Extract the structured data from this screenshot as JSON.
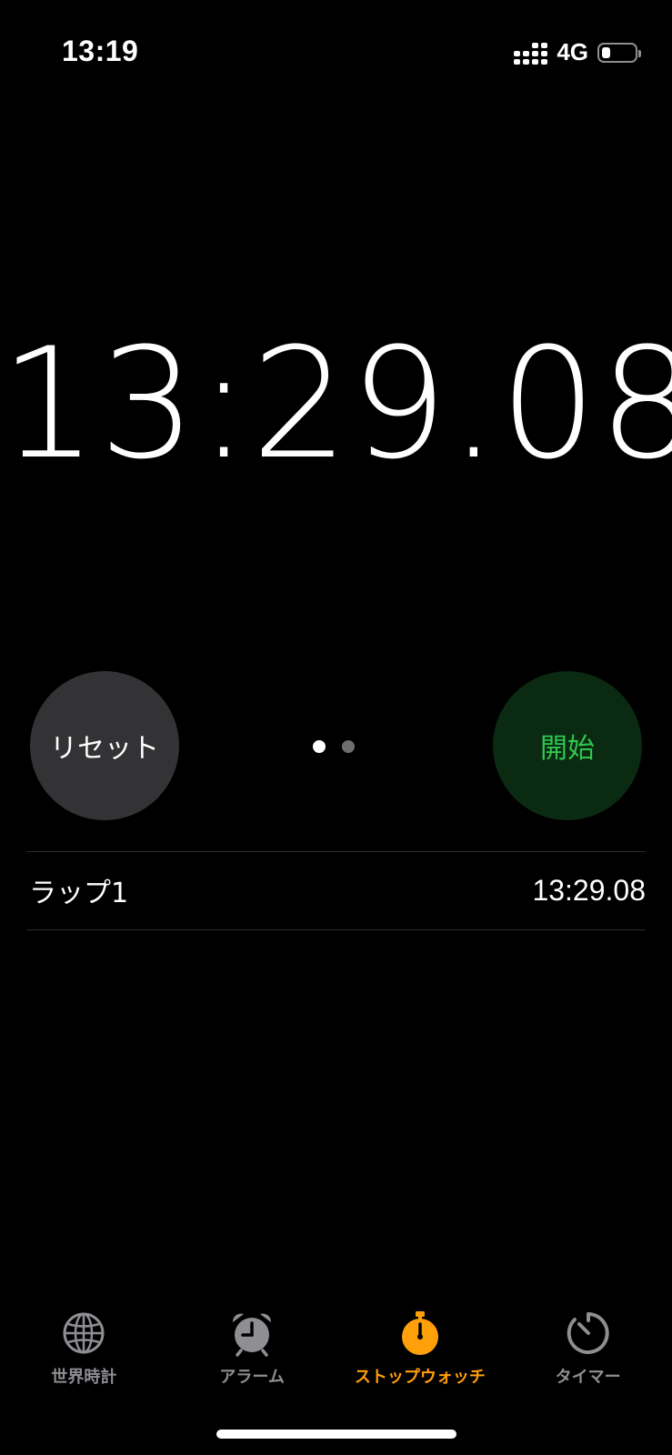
{
  "status_bar": {
    "time": "13:19",
    "network": "4G",
    "battery_level": 0.25
  },
  "stopwatch": {
    "elapsed": "13:29.08"
  },
  "controls": {
    "reset_label": "リセット",
    "start_label": "開始",
    "page_count": 2,
    "active_page": 1
  },
  "laps": [
    {
      "label": "ラップ1",
      "time": "13:29.08"
    }
  ],
  "tab_bar": {
    "active_index": 2,
    "tabs": [
      {
        "label": "世界時計",
        "icon": "globe-icon"
      },
      {
        "label": "アラーム",
        "icon": "alarm-clock-icon"
      },
      {
        "label": "ストップウォッチ",
        "icon": "stopwatch-icon"
      },
      {
        "label": "タイマー",
        "icon": "timer-icon"
      }
    ]
  },
  "colors": {
    "background": "#000000",
    "accent": "#ff9f0a",
    "start_text": "#31c74f",
    "start_bg": "#0a2a12",
    "reset_bg": "#333335",
    "inactive_tab": "#8e8e93"
  }
}
